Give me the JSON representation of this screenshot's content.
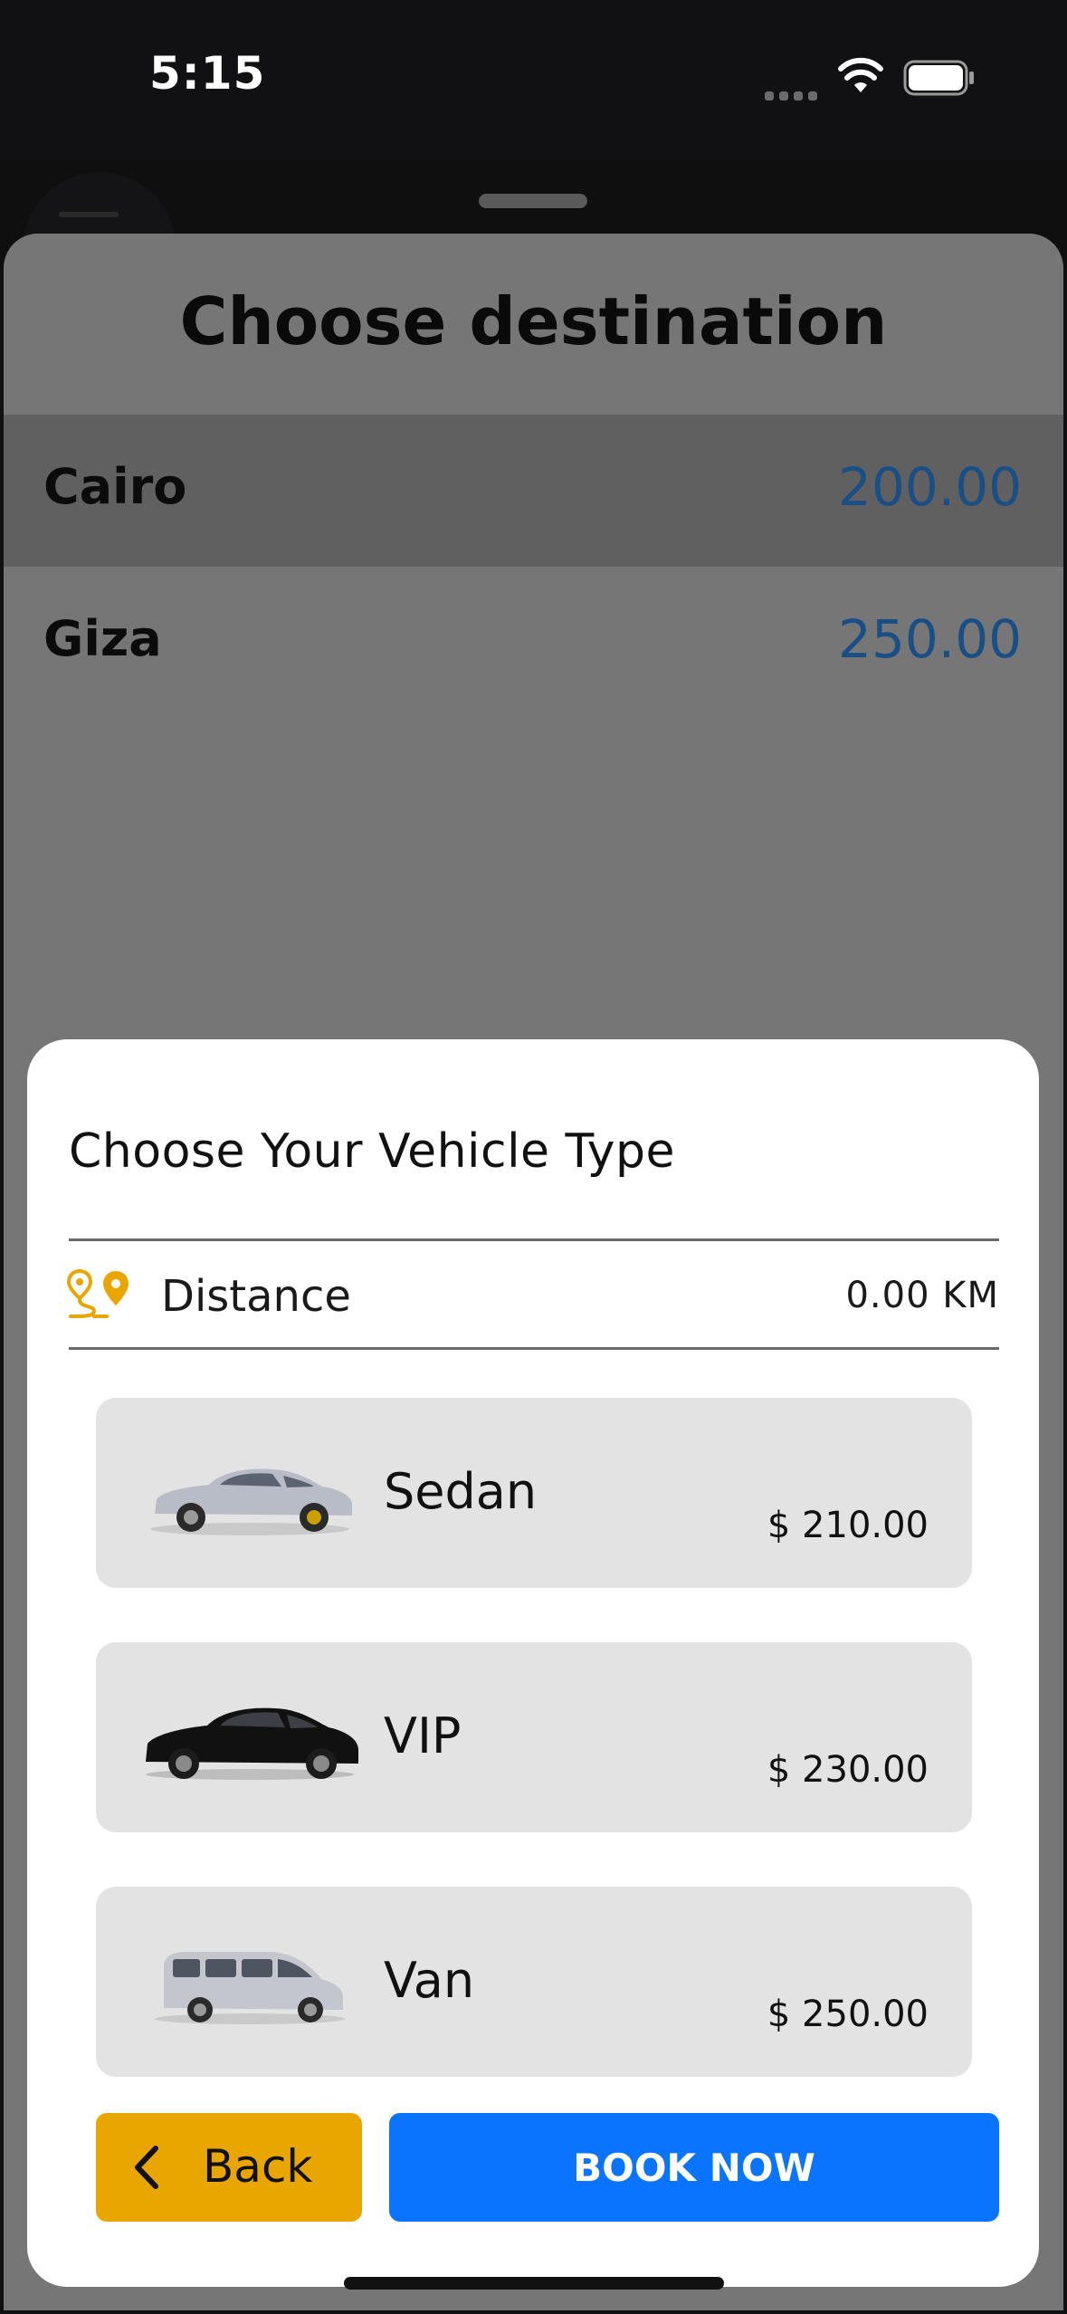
{
  "status_bar": {
    "time": "5:15"
  },
  "destination_sheet": {
    "title": "Choose destination",
    "destinations": [
      {
        "name": "Cairo",
        "price": "200.00",
        "selected": true
      },
      {
        "name": "Giza",
        "price": "250.00",
        "selected": false
      }
    ]
  },
  "vehicle_dialog": {
    "title": "Choose Your Vehicle Type",
    "distance": {
      "label": "Distance",
      "value": "0.00 KM",
      "icon": "route-pins-icon"
    },
    "vehicles": [
      {
        "name": "Sedan",
        "price": "$ 210.00",
        "image": "silver-sedan-image"
      },
      {
        "name": "VIP",
        "price": "$ 230.00",
        "image": "black-vip-car-image"
      },
      {
        "name": "Van",
        "price": "$ 250.00",
        "image": "silver-van-image"
      }
    ],
    "back_label": "Back",
    "book_label": "BOOK NOW"
  },
  "colors": {
    "accent_yellow": "#e9a500",
    "primary_blue": "#0a74ff",
    "price_blue": "#1a4f86"
  }
}
